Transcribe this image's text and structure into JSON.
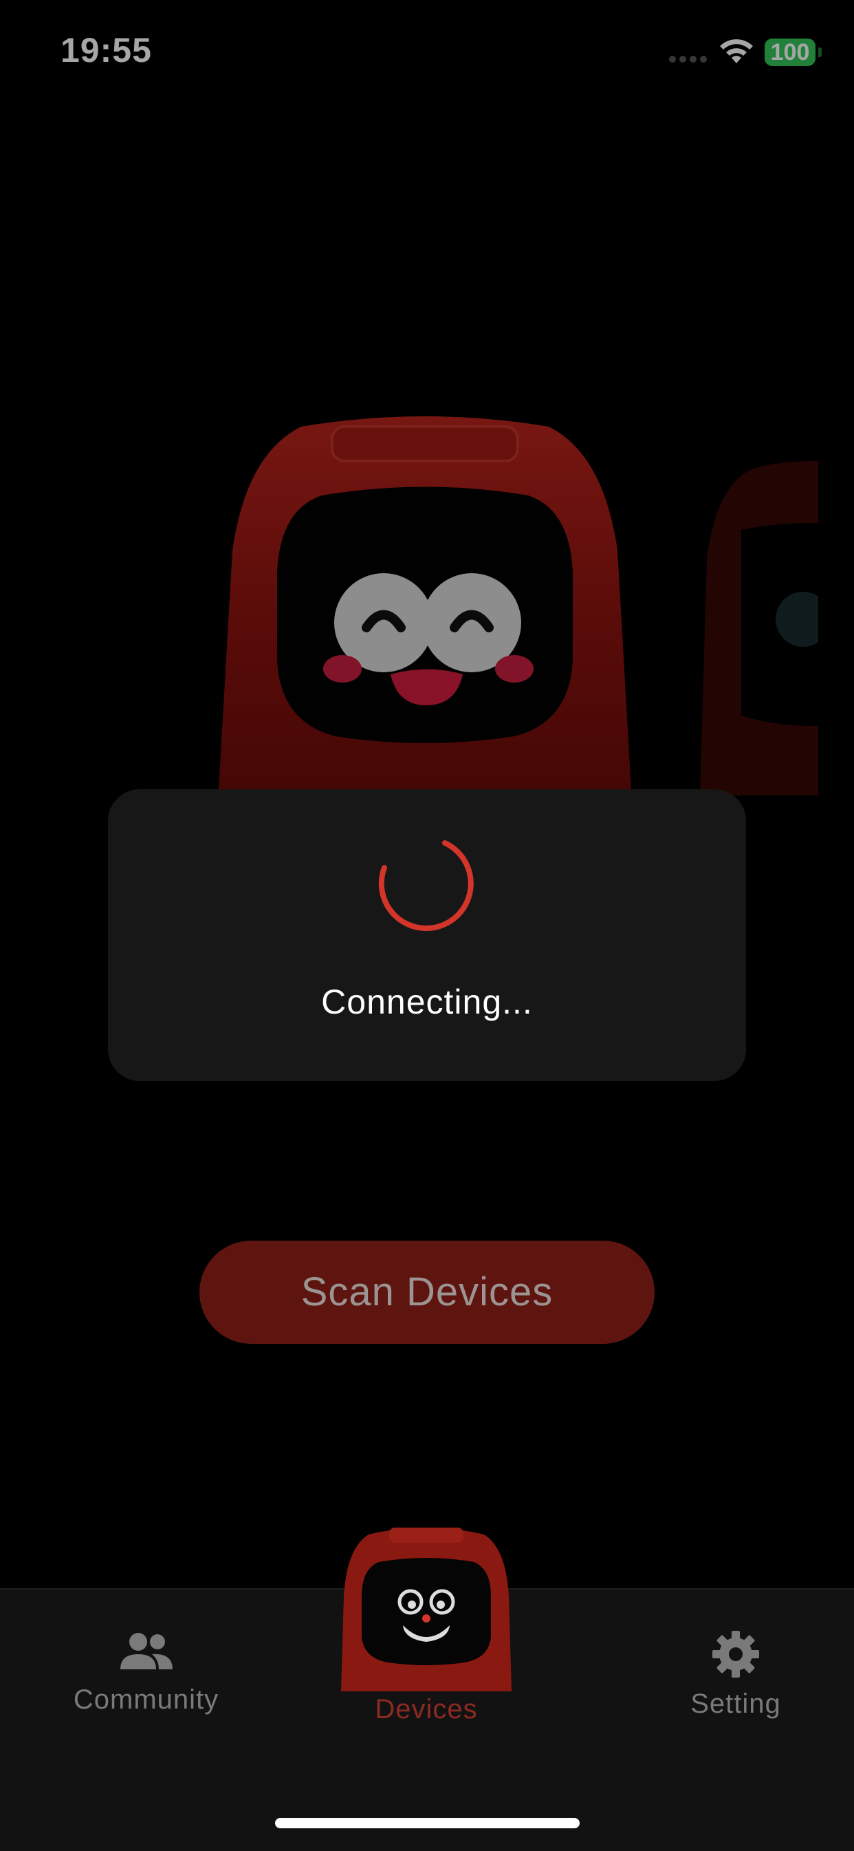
{
  "status_bar": {
    "time": "19:55",
    "battery": "100"
  },
  "toast": {
    "text": "Connecting..."
  },
  "scan_button": {
    "label": "Scan Devices"
  },
  "tabs": [
    {
      "label": "Community",
      "icon": "community-icon"
    },
    {
      "label": "Devices",
      "icon": "robot-icon"
    },
    {
      "label": "Setting",
      "icon": "gear-icon"
    }
  ],
  "colors": {
    "accent": "#d3352b",
    "button_bg": "#5e1510",
    "toast_bg": "#171717",
    "battery": "#34c759",
    "tabbar_bg": "#121212"
  }
}
